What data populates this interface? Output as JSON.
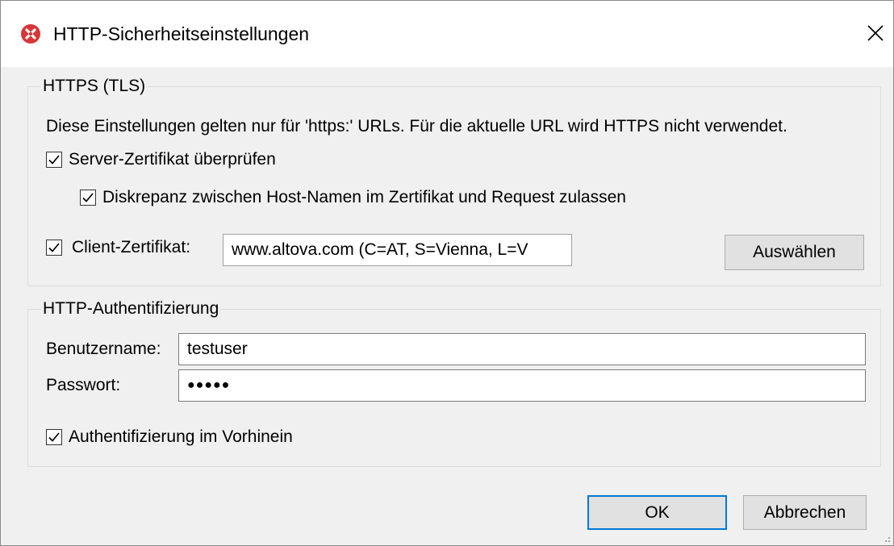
{
  "window": {
    "title": "HTTP-Sicherheitseinstellungen",
    "icon": "altova-app-icon",
    "close_icon": "close-icon"
  },
  "https_group": {
    "title": "HTTPS (TLS)",
    "info_text": "Diese Einstellungen gelten nur für 'https:' URLs. Für die aktuelle URL wird HTTPS nicht verwendet.",
    "verify_server_cert": {
      "label": "Server-Zertifikat überprüfen",
      "checked": true
    },
    "allow_host_mismatch": {
      "label": "Diskrepanz zwischen Host-Namen im Zertifikat und Request zulassen",
      "checked": true
    },
    "client_cert": {
      "label": "Client-Zertifikat:",
      "checked": true,
      "value": "www.altova.com (C=AT, S=Vienna, L=V",
      "select_button": "Auswählen"
    }
  },
  "auth_group": {
    "title": "HTTP-Authentifizierung",
    "username_label": "Benutzername:",
    "username_value": "testuser",
    "password_label": "Passwort:",
    "password_value": "●●●●●",
    "preemptive": {
      "label": "Authentifizierung im Vorhinein",
      "checked": true
    }
  },
  "buttons": {
    "ok": "OK",
    "cancel": "Abbrechen"
  },
  "colors": {
    "accent": "#0078d7",
    "icon_red": "#d6373a"
  }
}
